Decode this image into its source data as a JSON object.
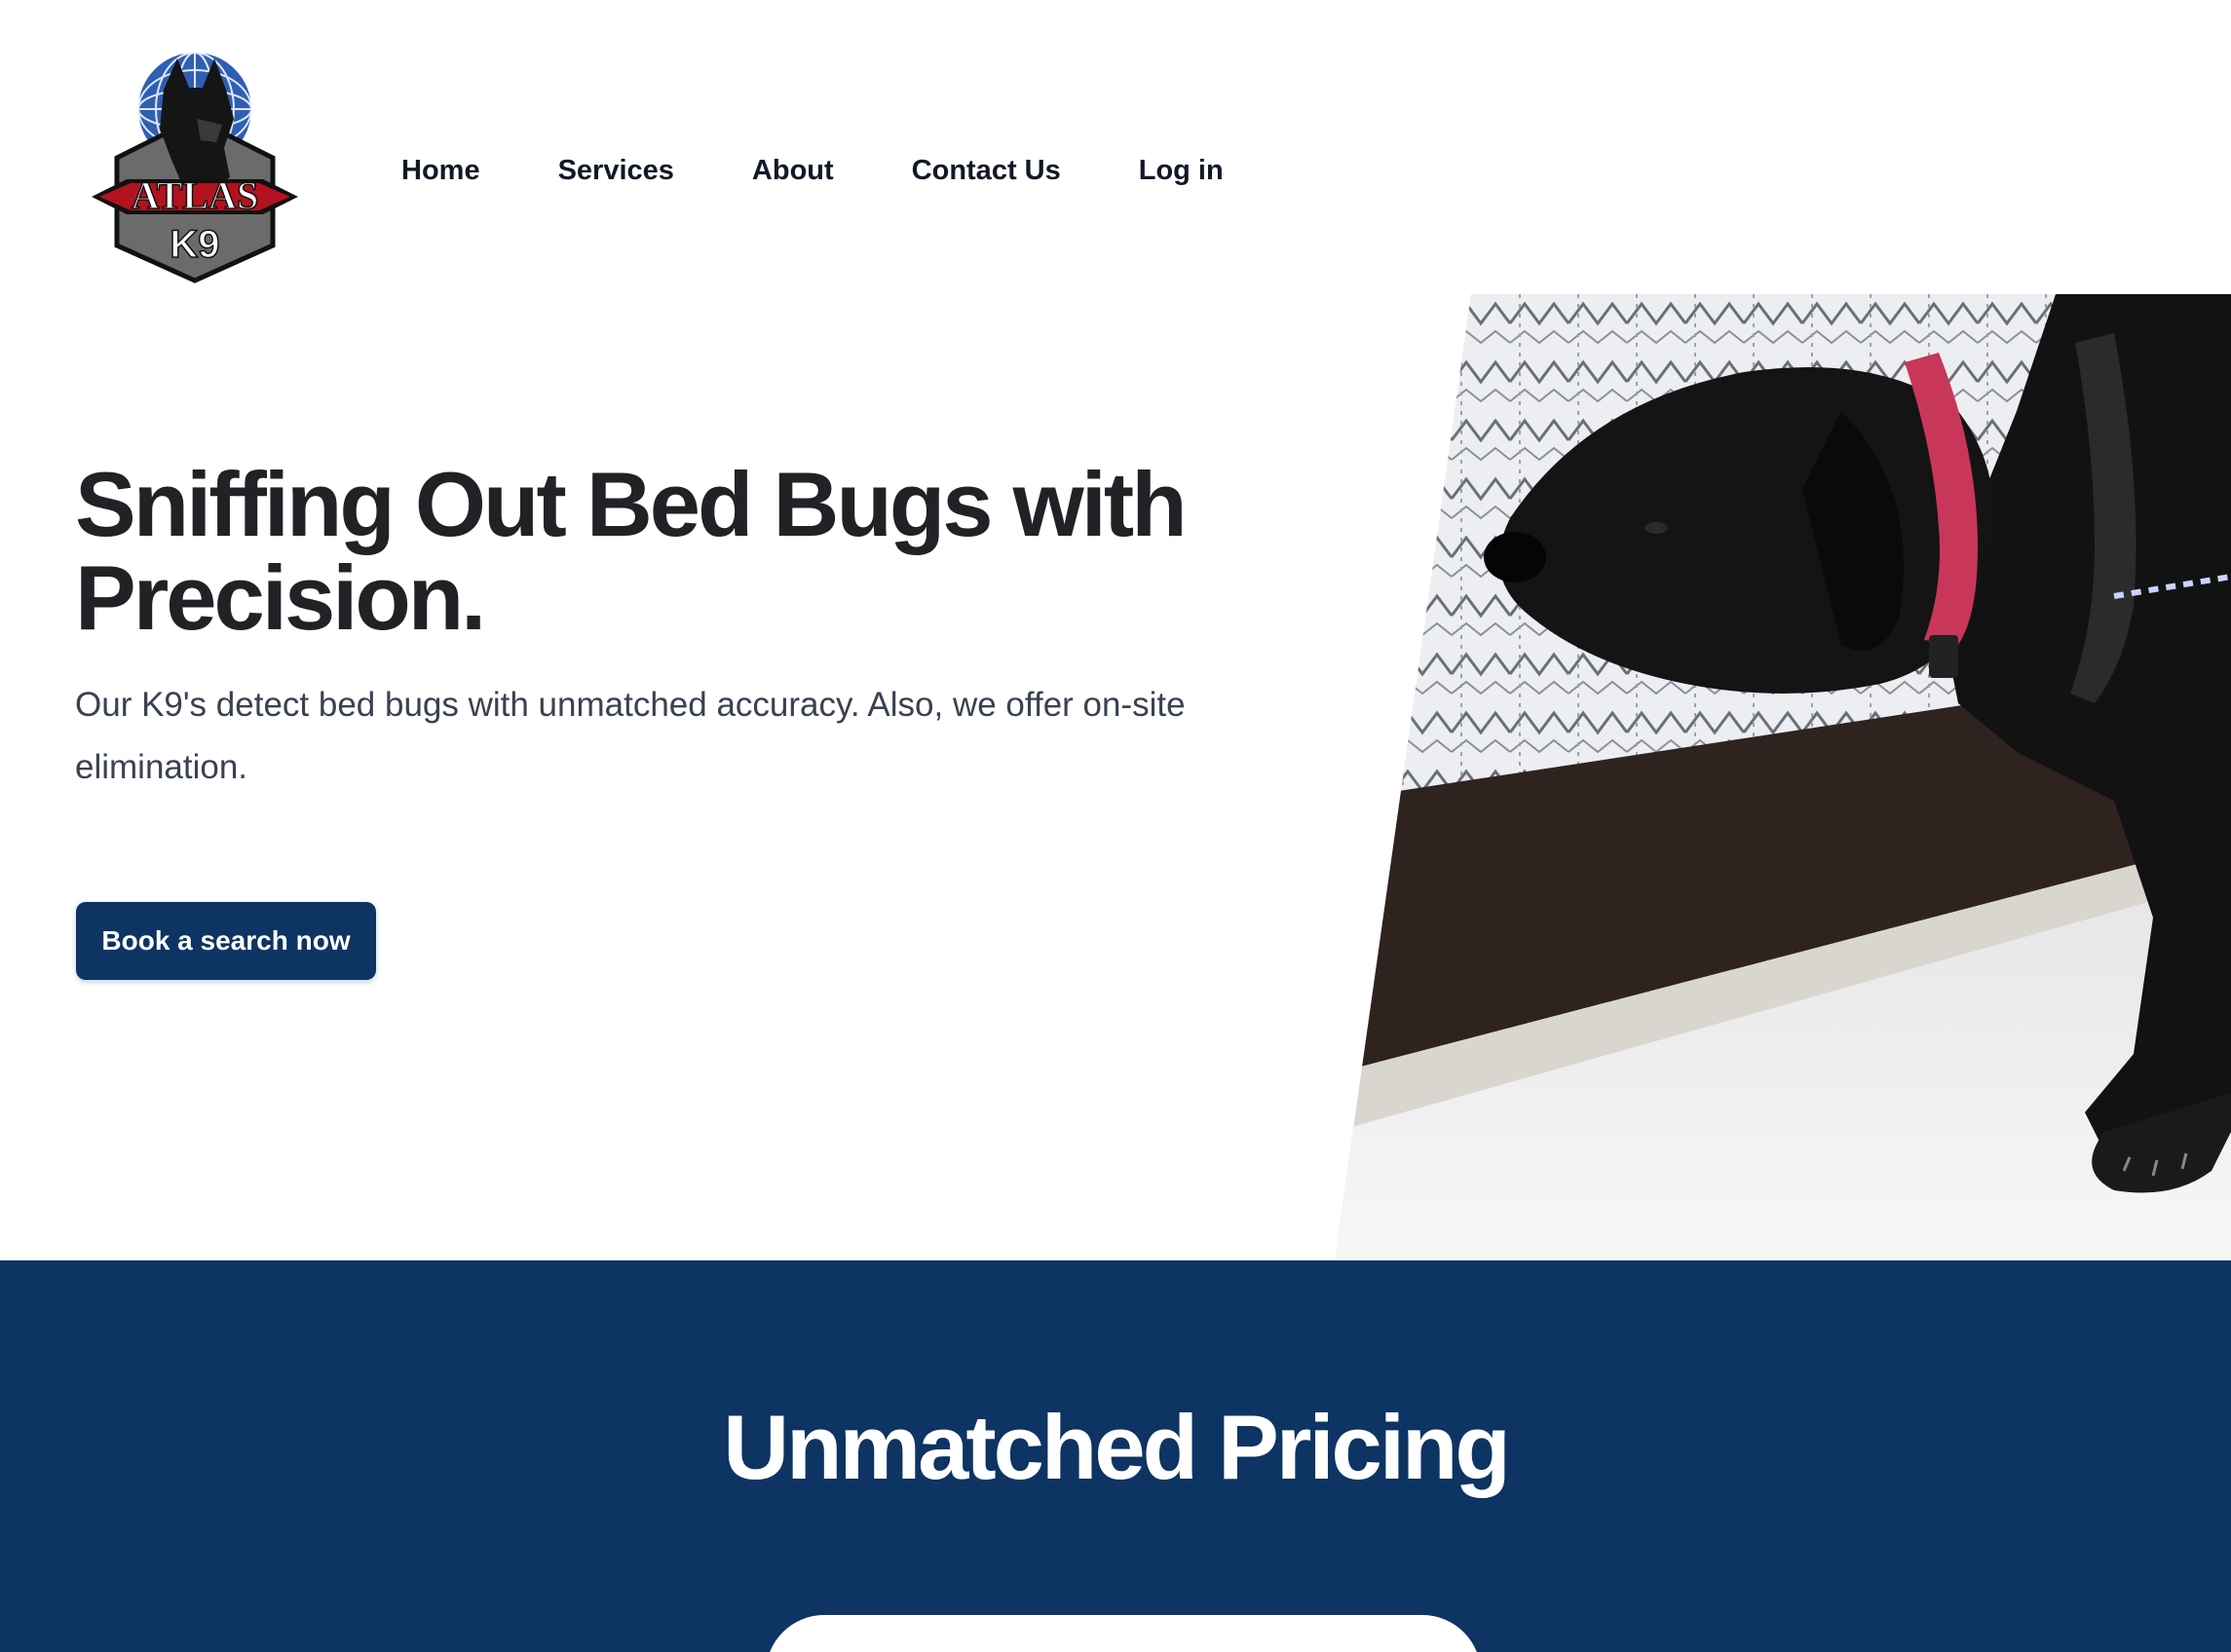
{
  "brand": {
    "logo_text_top": "ATLAS",
    "logo_text_bottom": "K9",
    "logo_icon": "atlas-k9-shield-logo"
  },
  "nav": {
    "items": [
      {
        "label": "Home"
      },
      {
        "label": "Services"
      },
      {
        "label": "About"
      },
      {
        "label": "Contact Us"
      },
      {
        "label": "Log in"
      }
    ]
  },
  "hero": {
    "title": "Sniffing Out Bed Bugs with Precision.",
    "subtitle": "Our K9's detect bed bugs with unmatched accuracy. Also, we offer on-site elimination.",
    "cta_label": "Book a search now",
    "image": "dog-sniffing-bed-photo"
  },
  "pricing": {
    "title": "Unmatched Pricing"
  },
  "colors": {
    "brand_navy": "#0d3462",
    "heading_dark": "#202226",
    "body_text": "#3a4150",
    "white": "#ffffff"
  }
}
